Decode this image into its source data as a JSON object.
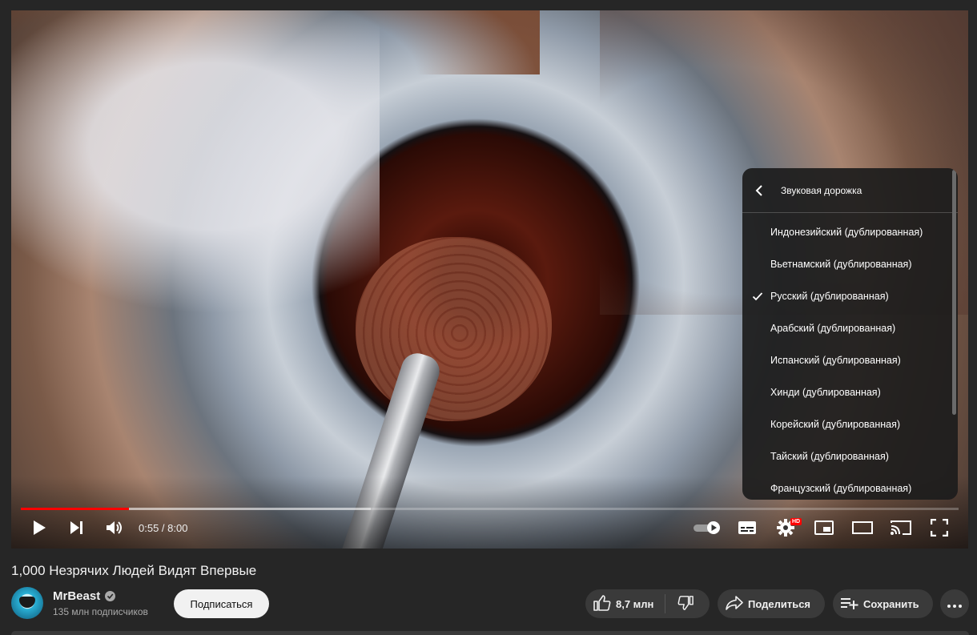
{
  "player": {
    "time_current": "0:55",
    "time_total": "8:00",
    "time_display": "0:55 / 8:00",
    "progress_played": 0.115,
    "progress_buffered": 0.373,
    "hd_badge": "HD",
    "accent_color": "#ff0000",
    "icons": [
      "play-icon",
      "next-icon",
      "volume-icon",
      "autoplay-toggle-icon",
      "subtitles-icon",
      "settings-icon",
      "miniplayer-icon",
      "theater-mode-icon",
      "cast-icon",
      "fullscreen-icon"
    ]
  },
  "audio_menu": {
    "title": "Звуковая дорожка",
    "items": [
      {
        "label": "Индонезийский (дублированная)",
        "selected": false
      },
      {
        "label": "Вьетнамский (дублированная)",
        "selected": false
      },
      {
        "label": "Русский (дублированная)",
        "selected": true
      },
      {
        "label": "Арабский (дублированная)",
        "selected": false
      },
      {
        "label": "Испанский (дублированная)",
        "selected": false
      },
      {
        "label": "Хинди (дублированная)",
        "selected": false
      },
      {
        "label": "Корейский (дублированная)",
        "selected": false
      },
      {
        "label": "Тайский (дублированная)",
        "selected": false
      },
      {
        "label": "Французский (дублированная)",
        "selected": false
      }
    ]
  },
  "video": {
    "title": "1,000 Незрячих Людей Видят Впервые",
    "channel": "MrBeast",
    "subscribers": "135 млн подписчиков",
    "subscribe_label": "Подписаться",
    "likes": "8,7 млн",
    "share_label": "Поделиться",
    "save_label": "Сохранить"
  }
}
